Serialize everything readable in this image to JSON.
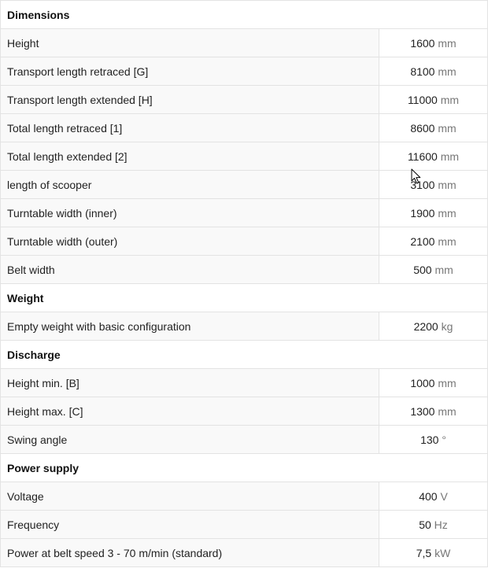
{
  "sections": [
    {
      "title": "Dimensions",
      "rows": [
        {
          "label": "Height",
          "value": "1600",
          "unit": "mm"
        },
        {
          "label": "Transport length retraced [G]",
          "value": "8100",
          "unit": "mm"
        },
        {
          "label": "Transport length extended [H]",
          "value": "11000",
          "unit": "mm"
        },
        {
          "label": "Total length retraced [1]",
          "value": "8600",
          "unit": "mm"
        },
        {
          "label": "Total length extended [2]",
          "value": "11600",
          "unit": "mm"
        },
        {
          "label": "length of scooper",
          "value": "3100",
          "unit": "mm"
        },
        {
          "label": "Turntable width (inner)",
          "value": "1900",
          "unit": "mm"
        },
        {
          "label": "Turntable width (outer)",
          "value": "2100",
          "unit": "mm"
        },
        {
          "label": "Belt width",
          "value": "500",
          "unit": "mm"
        }
      ]
    },
    {
      "title": "Weight",
      "rows": [
        {
          "label": "Empty weight with basic configuration",
          "value": "2200",
          "unit": "kg"
        }
      ]
    },
    {
      "title": "Discharge",
      "rows": [
        {
          "label": "Height min. [B]",
          "value": "1000",
          "unit": "mm"
        },
        {
          "label": "Height max. [C]",
          "value": "1300",
          "unit": "mm"
        },
        {
          "label": "Swing angle",
          "value": "130",
          "unit": "°"
        }
      ]
    },
    {
      "title": "Power supply",
      "rows": [
        {
          "label": "Voltage",
          "value": "400",
          "unit": "V"
        },
        {
          "label": "Frequency",
          "value": "50",
          "unit": "Hz"
        },
        {
          "label": "Power at belt speed 3 - 70 m/min (standard)",
          "value": "7,5",
          "unit": "kW"
        }
      ]
    }
  ],
  "icons": {
    "cursor": "mouse-pointer-icon"
  },
  "colors": {
    "label_cell_bg": "#f9f9f9",
    "value_cell_bg": "#ffffff",
    "border": "#e3e3e3",
    "unit_text": "#777777"
  }
}
